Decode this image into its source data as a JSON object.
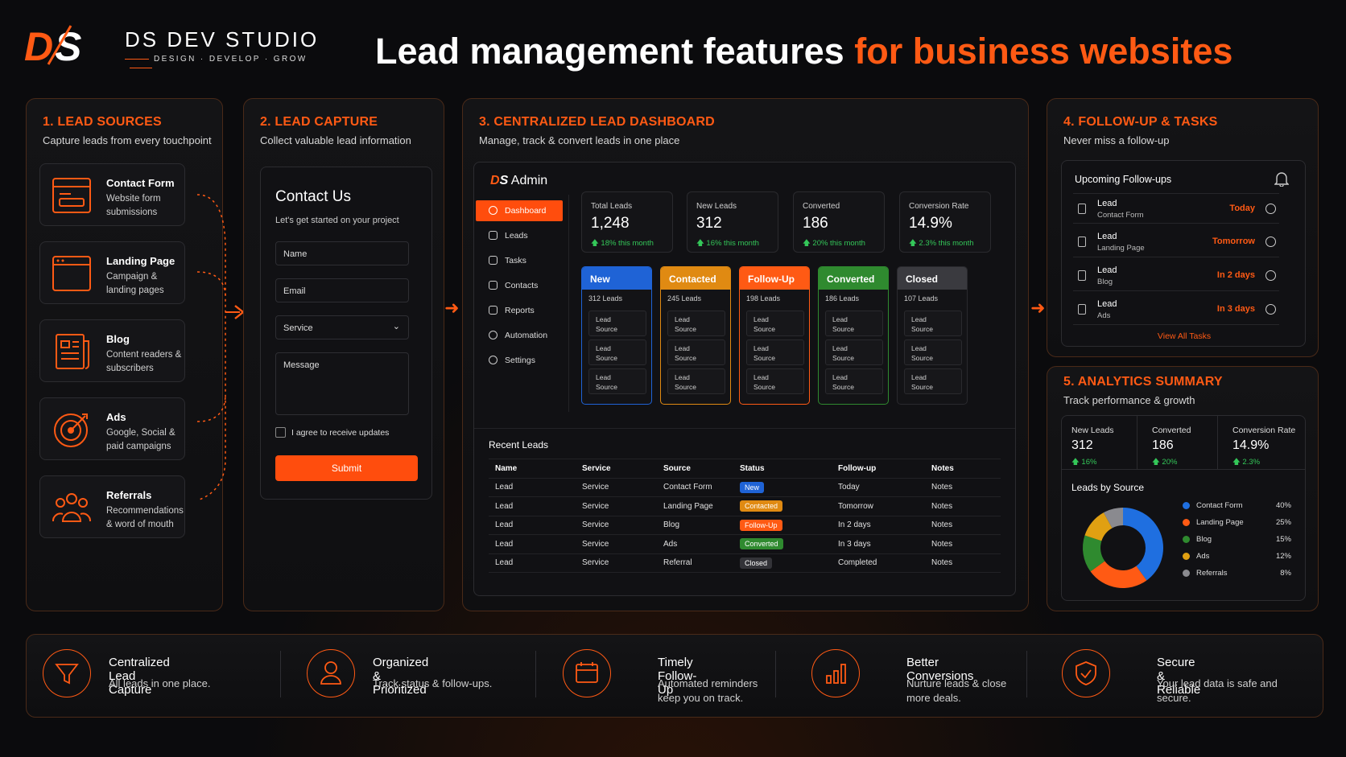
{
  "brand": {
    "logo": "DS",
    "name": "DS DEV STUDIO",
    "tagline": "DESIGN · DEVELOP · GROW"
  },
  "headline": {
    "part1": "Lead management features",
    "part2": "for business websites"
  },
  "sources": {
    "title": "1. LEAD SOURCES",
    "subtitle": "Capture leads from every touchpoint",
    "items": [
      {
        "title": "Contact Form",
        "desc": "Website form submissions",
        "icon": "form-icon"
      },
      {
        "title": "Landing Page",
        "desc": "Campaign & landing pages",
        "icon": "browser-icon"
      },
      {
        "title": "Blog",
        "desc": "Content readers & subscribers",
        "icon": "document-icon"
      },
      {
        "title": "Ads",
        "desc": "Google, Social & paid campaigns",
        "icon": "target-icon"
      },
      {
        "title": "Referrals",
        "desc": "Recommendations & word of mouth",
        "icon": "people-icon"
      }
    ]
  },
  "capture": {
    "title": "2. LEAD CAPTURE",
    "subtitle": "Collect valuable lead information",
    "form_title": "Contact Us",
    "form_sub": "Let's get started on your project",
    "name": "Name",
    "email": "Email",
    "service": "Service",
    "message": "Message",
    "agree": "I agree to receive updates",
    "submit": "Submit"
  },
  "dashboard": {
    "title": "3. CENTRALIZED LEAD DASHBOARD",
    "subtitle": "Manage, track & convert leads in one place",
    "app": "Admin",
    "nav": [
      "Dashboard",
      "Leads",
      "Tasks",
      "Contacts",
      "Reports",
      "Automation",
      "Settings"
    ],
    "stats": [
      {
        "label": "Total Leads",
        "value": "1,248",
        "change": "18% this month"
      },
      {
        "label": "New Leads",
        "value": "312",
        "change": "16% this month"
      },
      {
        "label": "Converted",
        "value": "186",
        "change": "20% this month"
      },
      {
        "label": "Conversion Rate",
        "value": "14.9%",
        "change": "2.3% this month"
      }
    ],
    "pipeline": [
      {
        "name": "New",
        "count": "312 Leads",
        "color": "#1f63d6"
      },
      {
        "name": "Contacted",
        "count": "245 Leads",
        "color": "#e08a12"
      },
      {
        "name": "Follow-Up",
        "count": "198 Leads",
        "color": "#ff5a14"
      },
      {
        "name": "Converted",
        "count": "186 Leads",
        "color": "#2f8a2f"
      },
      {
        "name": "Closed",
        "count": "107 Leads",
        "color": "#3a3a3f"
      }
    ],
    "card_line1": "Lead",
    "card_line2": "Source",
    "recent_title": "Recent Leads",
    "columns": [
      "Name",
      "Service",
      "Source",
      "Status",
      "Follow-up",
      "Notes"
    ],
    "rows": [
      [
        "Lead",
        "Service",
        "Contact Form",
        "New",
        "Today",
        "Notes"
      ],
      [
        "Lead",
        "Service",
        "Landing Page",
        "Contacted",
        "Tomorrow",
        "Notes"
      ],
      [
        "Lead",
        "Service",
        "Blog",
        "Follow-Up",
        "In 2 days",
        "Notes"
      ],
      [
        "Lead",
        "Service",
        "Ads",
        "Converted",
        "In 3 days",
        "Notes"
      ],
      [
        "Lead",
        "Service",
        "Referral",
        "Closed",
        "Completed",
        "Notes"
      ]
    ]
  },
  "followup": {
    "title": "4. FOLLOW-UP & TASKS",
    "subtitle": "Never miss a follow-up",
    "box_title": "Upcoming Follow-ups",
    "items": [
      {
        "name": "Lead",
        "source": "Contact Form",
        "when": "Today"
      },
      {
        "name": "Lead",
        "source": "Landing Page",
        "when": "Tomorrow"
      },
      {
        "name": "Lead",
        "source": "Blog",
        "when": "In 2 days"
      },
      {
        "name": "Lead",
        "source": "Ads",
        "when": "In 3 days"
      }
    ],
    "view_all": "View All Tasks"
  },
  "analytics": {
    "title": "5. ANALYTICS SUMMARY",
    "subtitle": "Track performance & growth",
    "stats": [
      {
        "label": "New Leads",
        "value": "312",
        "change": "16%"
      },
      {
        "label": "Converted",
        "value": "186",
        "change": "20%"
      },
      {
        "label": "Conversion Rate",
        "value": "14.9%",
        "change": "2.3%"
      }
    ],
    "chart_title": "Leads by Source"
  },
  "chart_data": {
    "type": "pie",
    "title": "Leads by Source",
    "categories": [
      "Contact Form",
      "Landing Page",
      "Blog",
      "Ads",
      "Referrals"
    ],
    "values": [
      40,
      25,
      15,
      12,
      8
    ],
    "labels": [
      "40%",
      "25%",
      "15%",
      "12%",
      "8%"
    ],
    "colors": [
      "#1f6fe0",
      "#ff5a14",
      "#2f8a2f",
      "#e0a012",
      "#8a8a8f"
    ]
  },
  "features": [
    {
      "title": "Centralized Lead Capture",
      "desc": "All leads in one place.",
      "icon": "funnel-icon"
    },
    {
      "title": "Organized & Prioritized",
      "desc": "Track status & follow-ups.",
      "icon": "user-icon"
    },
    {
      "title": "Timely Follow-Up",
      "desc": "Automated reminders keep you on track.",
      "icon": "calendar-icon"
    },
    {
      "title": "Better Conversions",
      "desc": "Nurture leads & close more deals.",
      "icon": "bar-chart-icon"
    },
    {
      "title": "Secure & Reliable",
      "desc": "Your lead data is safe and secure.",
      "icon": "shield-icon"
    }
  ]
}
